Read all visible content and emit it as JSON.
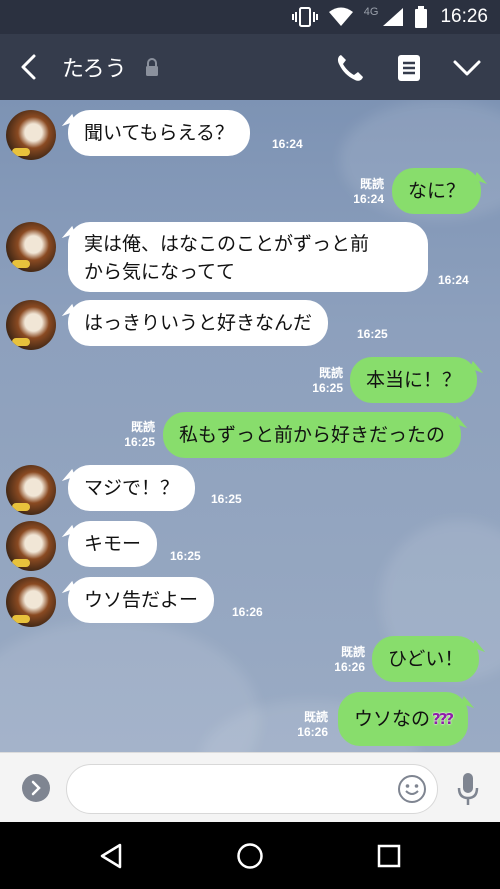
{
  "status_bar": {
    "network": "4G",
    "time": "16:26"
  },
  "header": {
    "back_icon": "chevron-left-icon",
    "contact_name": "たろう",
    "lock_icon": "lock-icon",
    "call_icon": "phone-icon",
    "notes_icon": "notes-icon",
    "menu_icon": "chevron-down-icon"
  },
  "colors": {
    "header": "#353c4c",
    "status_bar": "#2b3140",
    "outgoing_bubble": "#88dd6c",
    "incoming_bubble": "#ffffff",
    "chat_background": "#8da0bd"
  },
  "messages": [
    {
      "direction": "in",
      "text": "聞いてもらえる？",
      "time": "16:24"
    },
    {
      "direction": "out",
      "text": "なに？",
      "read": "既読",
      "time": "16:24"
    },
    {
      "direction": "in",
      "text_line1": "実は俺、はなこのことがずっと前",
      "text_line2": "から気になってて",
      "time": "16:24"
    },
    {
      "direction": "in",
      "text": "はっきりいうと好きなんだ",
      "time": "16:25"
    },
    {
      "direction": "out",
      "text": "本当に！？",
      "read": "既読",
      "time": "16:25"
    },
    {
      "direction": "out",
      "text": "私もずっと前から好きだったの",
      "read": "既読",
      "time": "16:25"
    },
    {
      "direction": "in",
      "text": "マジで！？",
      "time": "16:25"
    },
    {
      "direction": "in",
      "text": "キモー",
      "time": "16:25"
    },
    {
      "direction": "in",
      "text": "ウソ告だよー",
      "time": "16:26"
    },
    {
      "direction": "out",
      "text": "ひどい！",
      "read": "既読",
      "time": "16:26"
    },
    {
      "direction": "out",
      "text": "ウソなの",
      "emoji": "???",
      "read": "既読",
      "time": "16:26"
    }
  ],
  "input": {
    "placeholder": "",
    "expand_icon": "chevron-right-icon",
    "emoji_icon": "smiley-icon",
    "mic_icon": "microphone-icon"
  },
  "nav": {
    "back_icon": "triangle-back-icon",
    "home_icon": "circle-home-icon",
    "recents_icon": "square-recents-icon"
  }
}
